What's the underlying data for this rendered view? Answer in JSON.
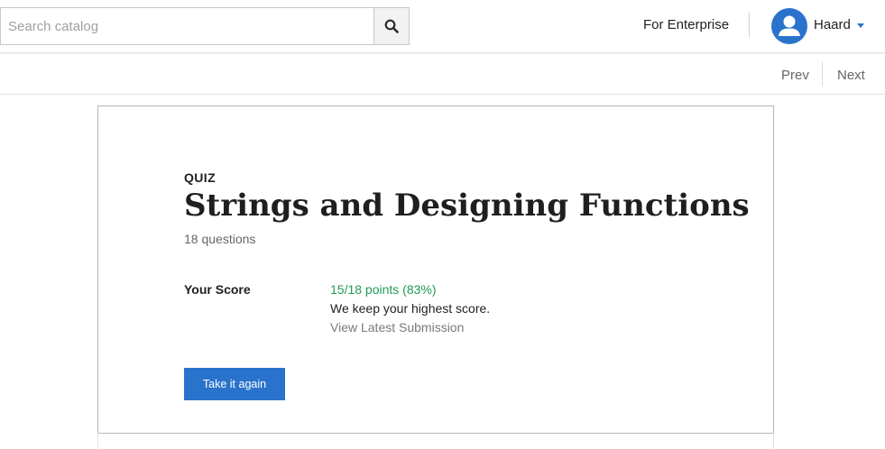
{
  "header": {
    "search": {
      "placeholder": "Search catalog",
      "value": ""
    },
    "search_icon": "search-icon",
    "enterprise_link": "For Enterprise",
    "user": {
      "name": "Haard",
      "avatar_icon": "person-icon",
      "dropdown_icon": "caret-down-icon"
    }
  },
  "subnav": {
    "prev_label": "Prev",
    "next_label": "Next"
  },
  "quiz": {
    "type_label": "QUIZ",
    "title": "Strings and Designing Functions",
    "question_count": "18 questions",
    "score_label": "Your Score",
    "score_value": "15/18 points (83%)",
    "score_note": "We keep your highest score.",
    "view_submission": "View Latest Submission",
    "retake_button": "Take it again"
  },
  "colors": {
    "accent": "#2a73cc",
    "score_green": "#1f9a57"
  }
}
